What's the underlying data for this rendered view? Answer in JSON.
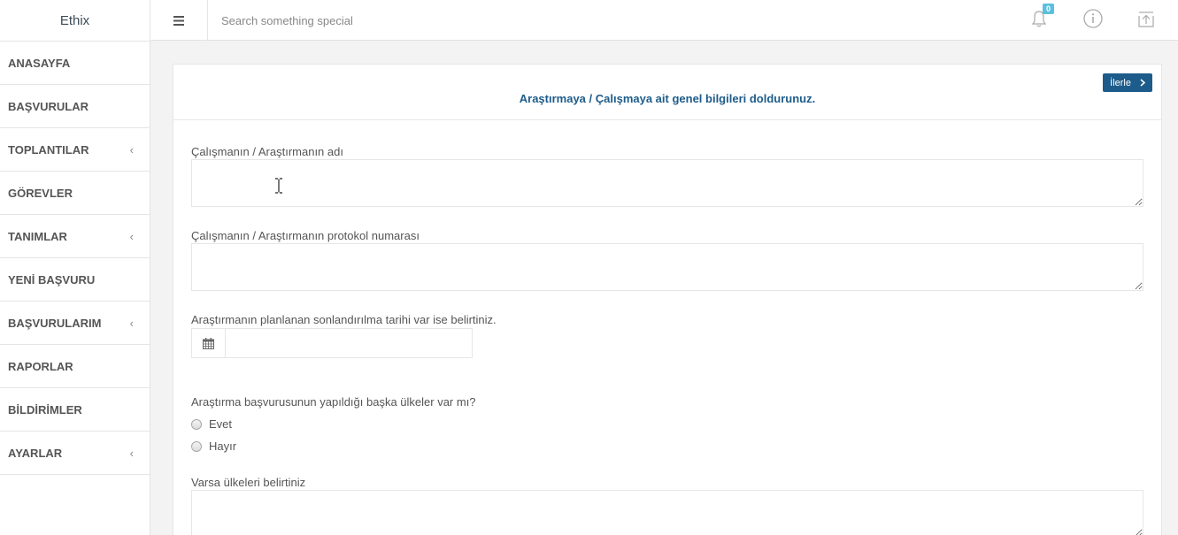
{
  "brand": "Ethix",
  "sidebar": {
    "items": [
      {
        "label": "ANASAYFA",
        "chevron": ""
      },
      {
        "label": "BAŞVURULAR",
        "chevron": ""
      },
      {
        "label": "TOPLANTILAR",
        "chevron": "‹"
      },
      {
        "label": "GÖREVLER",
        "chevron": ""
      },
      {
        "label": "TANIMLAR",
        "chevron": "‹"
      },
      {
        "label": "YENİ BAŞVURU",
        "chevron": ""
      },
      {
        "label": "BAŞVURULARIM",
        "chevron": "‹"
      },
      {
        "label": "RAPORLAR",
        "chevron": ""
      },
      {
        "label": "BİLDİRİMLER",
        "chevron": ""
      },
      {
        "label": "AYARLAR",
        "chevron": "‹"
      }
    ]
  },
  "topbar": {
    "search_placeholder": "Search something special",
    "notification_count": "0",
    "icons": [
      "menu-icon",
      "bell-icon",
      "info-icon",
      "upload-icon"
    ]
  },
  "form": {
    "title": "Araştırmaya / Çalışmaya ait genel bilgileri doldurunuz.",
    "next_label": "İlerle",
    "study_name_label": "Çalışmanın / Araştırmanın adı",
    "study_name_value": "",
    "protocol_label": "Çalışmanın / Araştırmanın protokol numarası",
    "protocol_value": "",
    "end_date_label": "Araştırmanın planlanan sonlandırılma tarihi var ise belirtiniz.",
    "end_date_value": "",
    "other_countries_question": "Araştırma başvurusunun yapıldığı başka ülkeler var mı?",
    "options": [
      "Evet",
      "Hayır"
    ],
    "countries_label": "Varsa ülkeleri belirtiniz",
    "countries_value": ""
  },
  "colors": {
    "accent": "#1d5c8a",
    "badge": "#5bc0de",
    "background": "#f3f3f4"
  }
}
